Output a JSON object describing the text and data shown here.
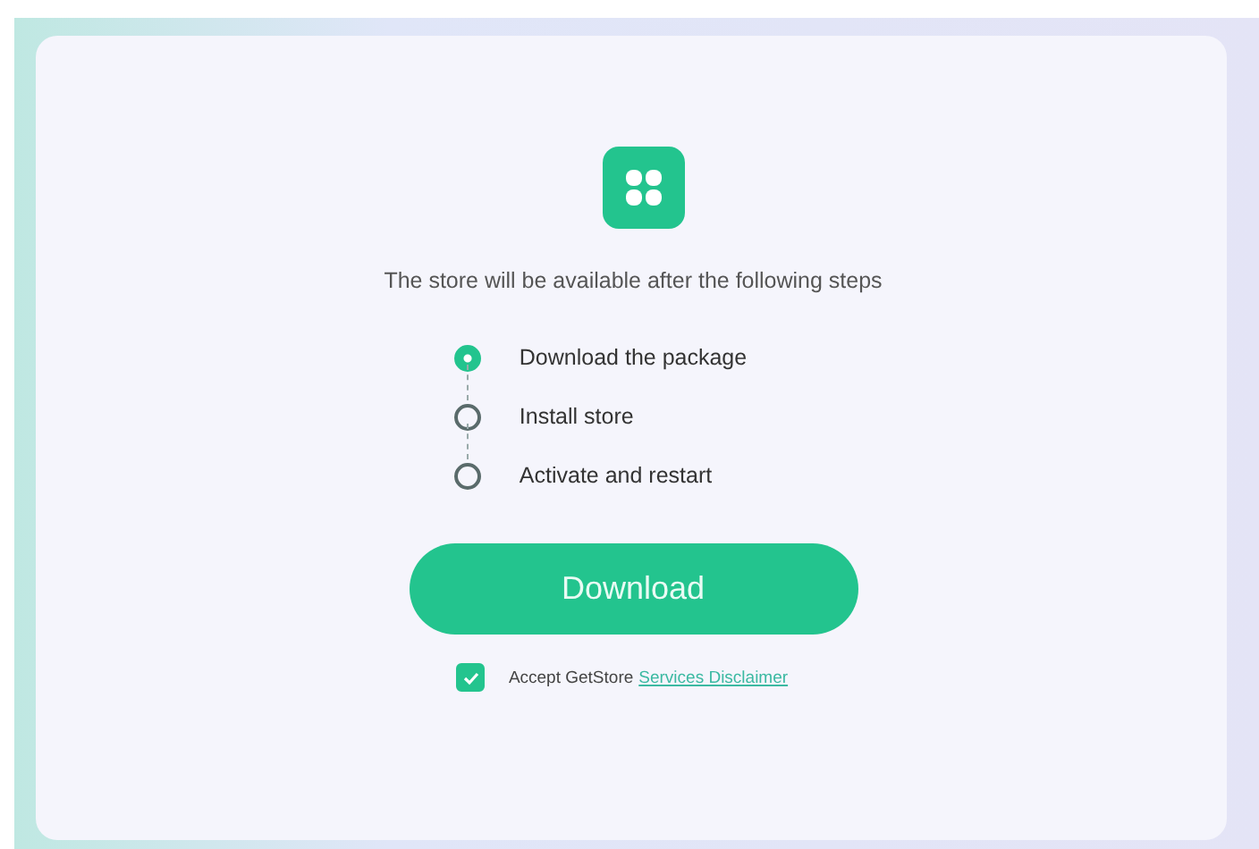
{
  "message": "The store will be available after the following steps",
  "steps": [
    {
      "label": "Download the package",
      "active": true
    },
    {
      "label": "Install store",
      "active": false
    },
    {
      "label": "Activate and restart",
      "active": false
    }
  ],
  "download_button": {
    "label": "Download"
  },
  "consent": {
    "checked": true,
    "text": "Accept GetStore",
    "link": "Services Disclaimer"
  }
}
